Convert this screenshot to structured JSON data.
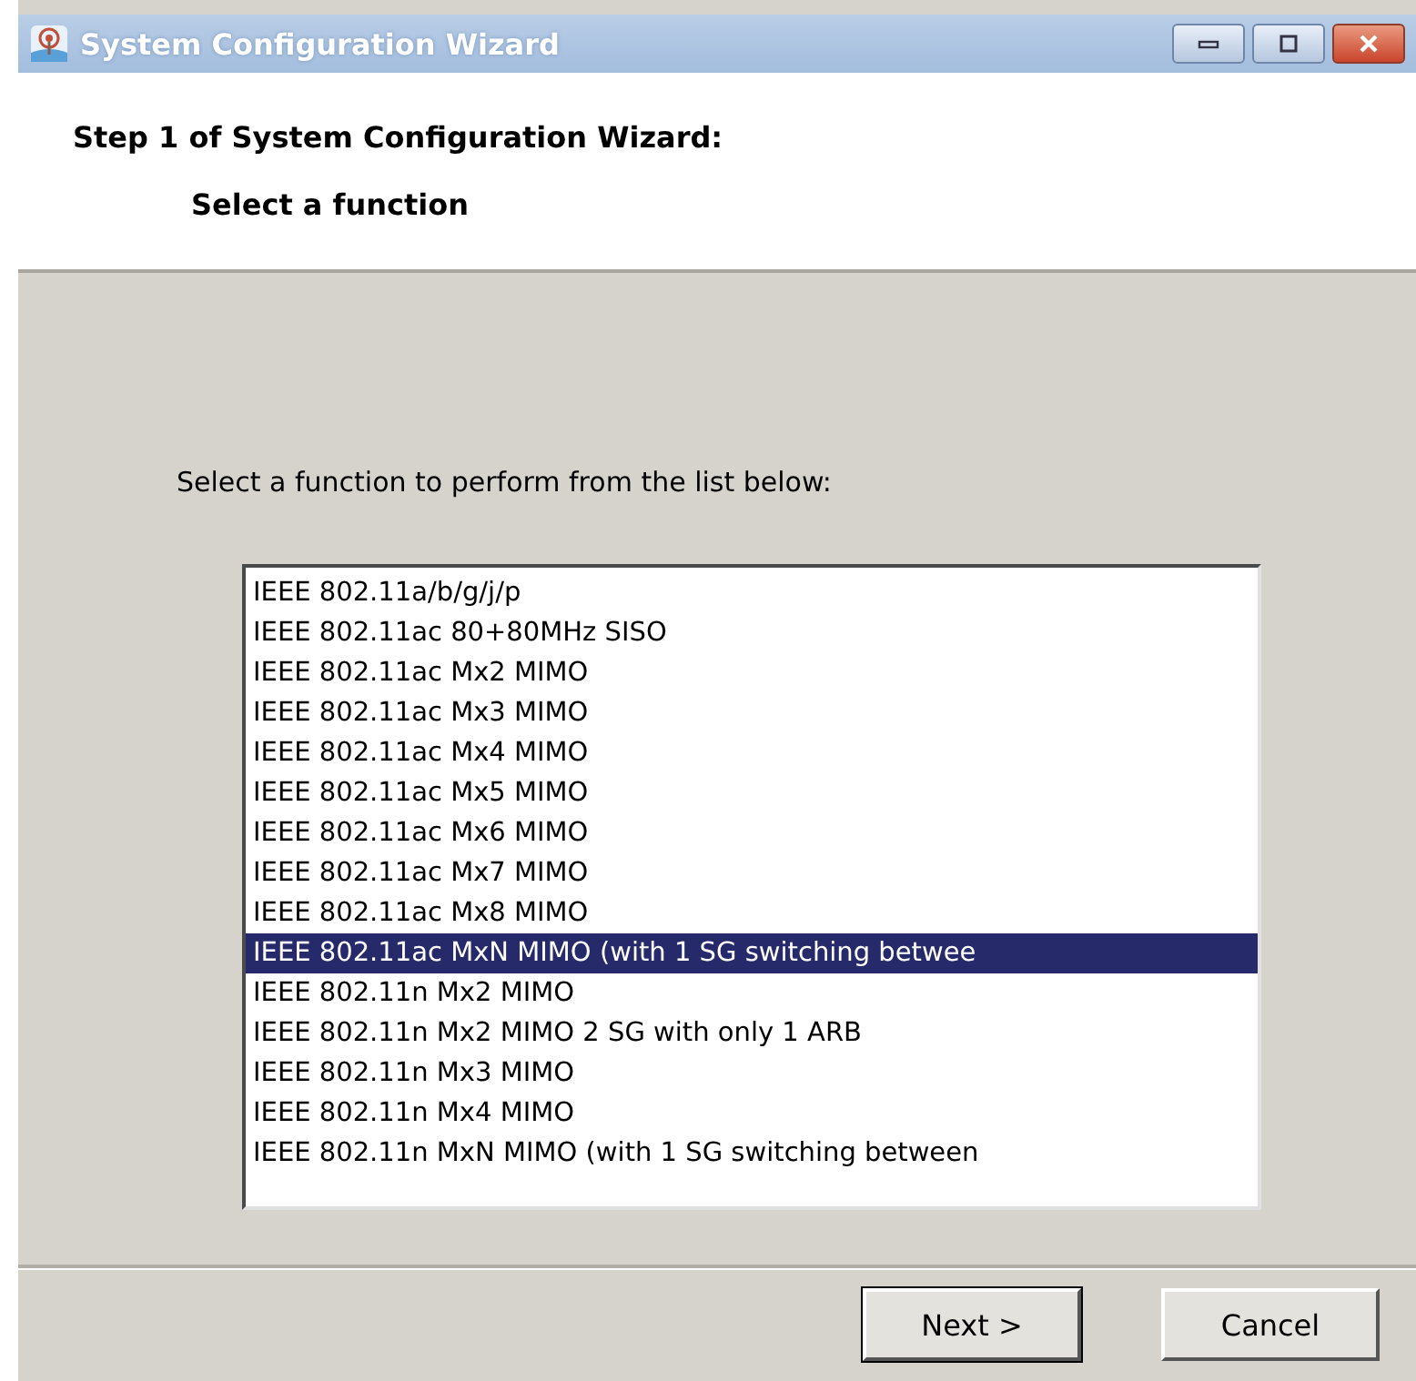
{
  "window": {
    "title": "System Configuration Wizard"
  },
  "header": {
    "title": "Step 1 of System Configuration Wizard:",
    "subtitle": "Select a function"
  },
  "prompt": "Select a function to perform from the list below:",
  "functions": [
    {
      "label": "IEEE 802.11a/b/g/j/p",
      "selected": false
    },
    {
      "label": "IEEE 802.11ac 80+80MHz SISO",
      "selected": false
    },
    {
      "label": "IEEE 802.11ac Mx2 MIMO",
      "selected": false
    },
    {
      "label": "IEEE 802.11ac Mx3 MIMO",
      "selected": false
    },
    {
      "label": "IEEE 802.11ac Mx4 MIMO",
      "selected": false
    },
    {
      "label": "IEEE 802.11ac Mx5 MIMO",
      "selected": false
    },
    {
      "label": "IEEE 802.11ac Mx6 MIMO",
      "selected": false
    },
    {
      "label": "IEEE 802.11ac Mx7 MIMO",
      "selected": false
    },
    {
      "label": "IEEE 802.11ac Mx8 MIMO",
      "selected": false
    },
    {
      "label": "IEEE 802.11ac MxN MIMO (with 1 SG switching betwee",
      "selected": true
    },
    {
      "label": "IEEE 802.11n Mx2 MIMO",
      "selected": false
    },
    {
      "label": "IEEE 802.11n Mx2 MIMO 2 SG with only 1 ARB",
      "selected": false
    },
    {
      "label": "IEEE 802.11n Mx3 MIMO",
      "selected": false
    },
    {
      "label": "IEEE 802.11n Mx4 MIMO",
      "selected": false
    },
    {
      "label": "IEEE 802.11n MxN MIMO (with 1 SG switching between",
      "selected": false
    }
  ],
  "buttons": [
    {
      "label": "Next >",
      "default": true
    },
    {
      "label": "Cancel",
      "default": false
    }
  ]
}
